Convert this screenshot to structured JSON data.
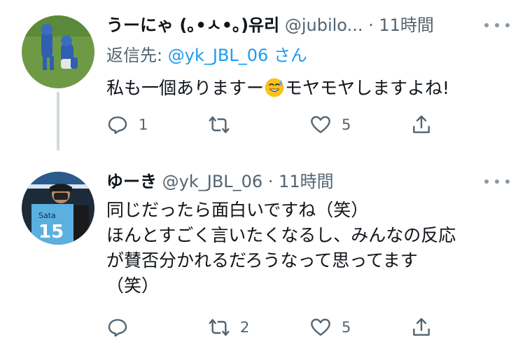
{
  "tweets": [
    {
      "name": "うーにゃ (｡•ㅅ•｡)유리",
      "handle": "@jubilo...",
      "dot": "·",
      "time": "11時間",
      "reply_label": "返信先:",
      "reply_to": "@yk_JBL_06",
      "reply_suffix": "さん",
      "lines": [
        "私も一個ありますー",
        "モヤモヤしますよね!"
      ],
      "emoji": "sweat-smile-emoji",
      "stats": {
        "replies": "1",
        "retweets": "",
        "likes": "5"
      }
    },
    {
      "name": "ゆーき",
      "handle": "@yk_JBL_06",
      "dot": "·",
      "time": "11時間",
      "lines": [
        "同じだったら面白いですね（笑）",
        "ほんとすごく言いたくなるし、みんなの反応",
        "が賛否分かれるだろうなって思ってます",
        "（笑）"
      ],
      "stats": {
        "replies": "",
        "retweets": "2",
        "likes": "5"
      }
    }
  ],
  "colors": {
    "text": "#0f1419",
    "secondary": "#536471",
    "link": "#1d9bf0",
    "thread": "#cfd9de"
  }
}
